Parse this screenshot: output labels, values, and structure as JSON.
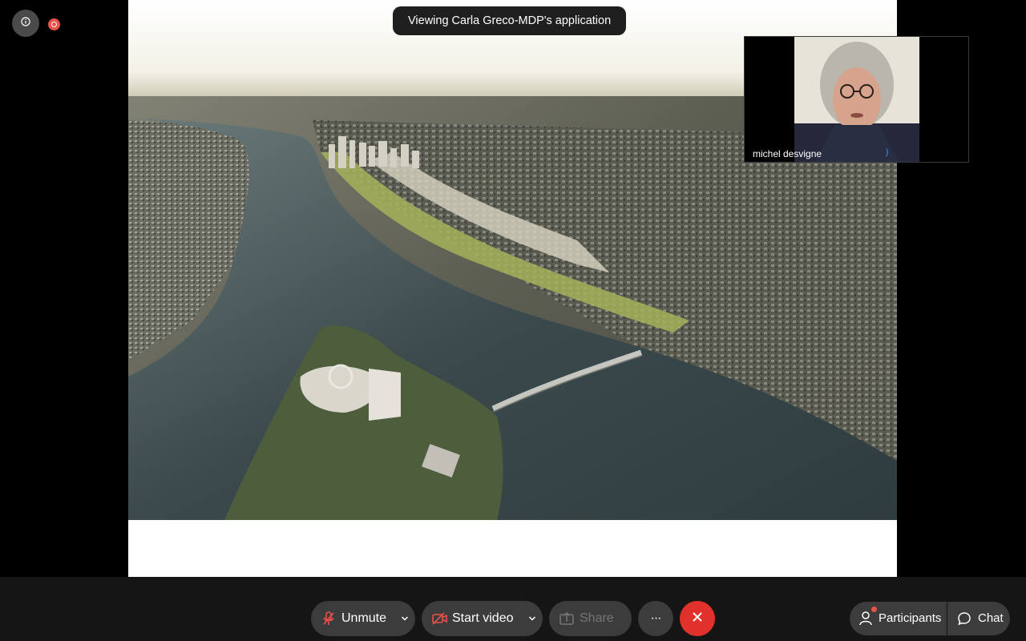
{
  "banner": {
    "text": "Viewing Carla Greco-MDP's application"
  },
  "participant": {
    "name": "michel desvigne",
    "audio_indicator": ")"
  },
  "toolbar": {
    "unmute_label": "Unmute",
    "start_video_label": "Start video",
    "share_label": "Share",
    "participants_label": "Participants",
    "chat_label": "Chat",
    "more_glyph": "···"
  },
  "icons": {
    "info": "info-icon",
    "recording": "recording-icon",
    "mic_muted": "microphone-muted-icon",
    "camera_off": "camera-off-icon",
    "share": "share-icon",
    "more": "more-icon",
    "end_call": "close-icon",
    "participants": "person-icon",
    "chat": "chat-bubble-icon",
    "chevron": "chevron-down-icon"
  },
  "colors": {
    "end_call": "#e0312a",
    "recording": "#e8524a",
    "mic_muted": "#e8524a",
    "toolbar_button": "#3c3c3c",
    "background": "#000000"
  }
}
